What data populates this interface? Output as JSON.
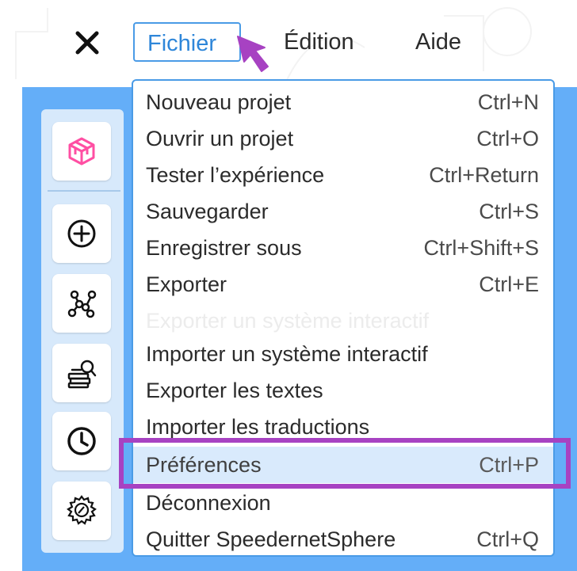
{
  "menubar": {
    "items": [
      {
        "label": "Fichier",
        "active": true
      },
      {
        "label": "Édition"
      },
      {
        "label": "Aide"
      }
    ]
  },
  "toolbar": {
    "icons": [
      "cube-icon",
      "plus-circle-icon",
      "graph-network-icon",
      "book-search-icon",
      "history-clock-icon",
      "settings-gear-icon"
    ]
  },
  "file_menu": {
    "items": [
      {
        "label": "Nouveau projet",
        "shortcut": "Ctrl+N"
      },
      {
        "label": "Ouvrir un projet",
        "shortcut": "Ctrl+O"
      },
      {
        "label": "Tester l’expérience",
        "shortcut": "Ctrl+Return"
      },
      {
        "label": "Sauvegarder",
        "shortcut": "Ctrl+S"
      },
      {
        "label": "Enregistrer sous",
        "shortcut": "Ctrl+Shift+S"
      },
      {
        "label": "Exporter",
        "shortcut": "Ctrl+E"
      },
      {
        "label": "Exporter un système interactif",
        "shortcut": "",
        "disabled": true
      },
      {
        "label": "Importer un système interactif",
        "shortcut": ""
      },
      {
        "label": "Exporter les textes",
        "shortcut": ""
      },
      {
        "label": "Importer les traductions",
        "shortcut": ""
      },
      {
        "label": "Préférences",
        "shortcut": "Ctrl+P",
        "highlighted": true
      },
      {
        "label": "Déconnexion",
        "shortcut": ""
      },
      {
        "label": "Quitter SpeedernetSphere",
        "shortcut": "Ctrl+Q"
      }
    ]
  },
  "colors": {
    "accent": "#4a9be6",
    "app_background": "#64aef8",
    "highlight": "#d9eafc",
    "annotation": "#a742c2",
    "cube_icon": "#ff4fa3"
  }
}
